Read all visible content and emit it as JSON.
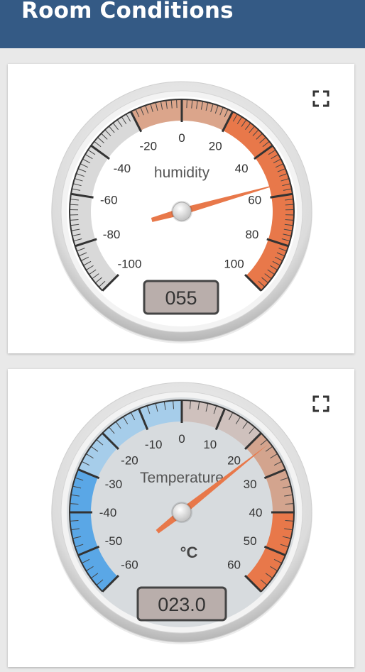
{
  "header": {
    "title": "Room Conditions"
  },
  "gauges": [
    {
      "title": "humidity",
      "units": "",
      "value": 55,
      "value_display": "055",
      "min": -100,
      "max": 100,
      "major_ticks": [
        "-100",
        "-80",
        "-60",
        "-40",
        "-20",
        "0",
        "20",
        "40",
        "60",
        "80",
        "100"
      ],
      "highlights": [
        {
          "from": -100,
          "to": -20,
          "color": "#d9d9d9"
        },
        {
          "from": -20,
          "to": 20,
          "color": "#dba58b"
        },
        {
          "from": 20,
          "to": 100,
          "color": "#e8784a"
        }
      ],
      "fullscreen_icon": "fullscreen-icon"
    },
    {
      "title": "Temperature",
      "units": "°C",
      "value": 23,
      "value_display": "023.0",
      "min": -60,
      "max": 60,
      "major_ticks": [
        "-60",
        "-50",
        "-40",
        "-30",
        "-20",
        "-10",
        "0",
        "10",
        "20",
        "30",
        "40",
        "50",
        "60"
      ],
      "highlights": [
        {
          "from": -60,
          "to": -30,
          "color": "#5aa7e6"
        },
        {
          "from": -30,
          "to": 0,
          "color": "#a6cdea"
        },
        {
          "from": 0,
          "to": 20,
          "color": "#cfc1bd"
        },
        {
          "from": 20,
          "to": 40,
          "color": "#d3a48e"
        },
        {
          "from": 40,
          "to": 60,
          "color": "#e8784a"
        }
      ],
      "fullscreen_icon": "fullscreen-icon"
    }
  ],
  "colors": {
    "header_bg": "#345a85",
    "needle": "#e8784a",
    "value_box": "#b9aeab",
    "humidity_face": "#ffffff",
    "temperature_face": "#d7dbde"
  }
}
